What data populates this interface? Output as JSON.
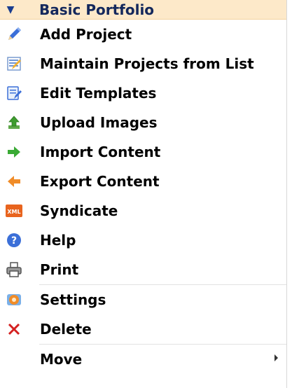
{
  "menu": {
    "title": "Basic Portfolio",
    "items": [
      {
        "label": "Add Project",
        "icon": "pencil-icon"
      },
      {
        "label": "Maintain Projects from List",
        "icon": "list-edit-icon"
      },
      {
        "label": "Edit Templates",
        "icon": "template-icon"
      },
      {
        "label": "Upload Images",
        "icon": "upload-icon"
      },
      {
        "label": "Import Content",
        "icon": "import-arrow-icon"
      },
      {
        "label": "Export Content",
        "icon": "export-arrow-icon"
      },
      {
        "label": "Syndicate",
        "icon": "xml-icon"
      },
      {
        "label": "Help",
        "icon": "help-icon"
      },
      {
        "label": "Print",
        "icon": "printer-icon"
      },
      {
        "label": "Settings",
        "icon": "settings-icon"
      },
      {
        "label": "Delete",
        "icon": "delete-icon"
      },
      {
        "label": "Move",
        "icon": ""
      }
    ]
  },
  "colors": {
    "header_bg": "#fde9c9",
    "title_text": "#14285c",
    "import_green": "#3aaa35",
    "export_orange": "#f08c28",
    "delete_red": "#d42020"
  }
}
